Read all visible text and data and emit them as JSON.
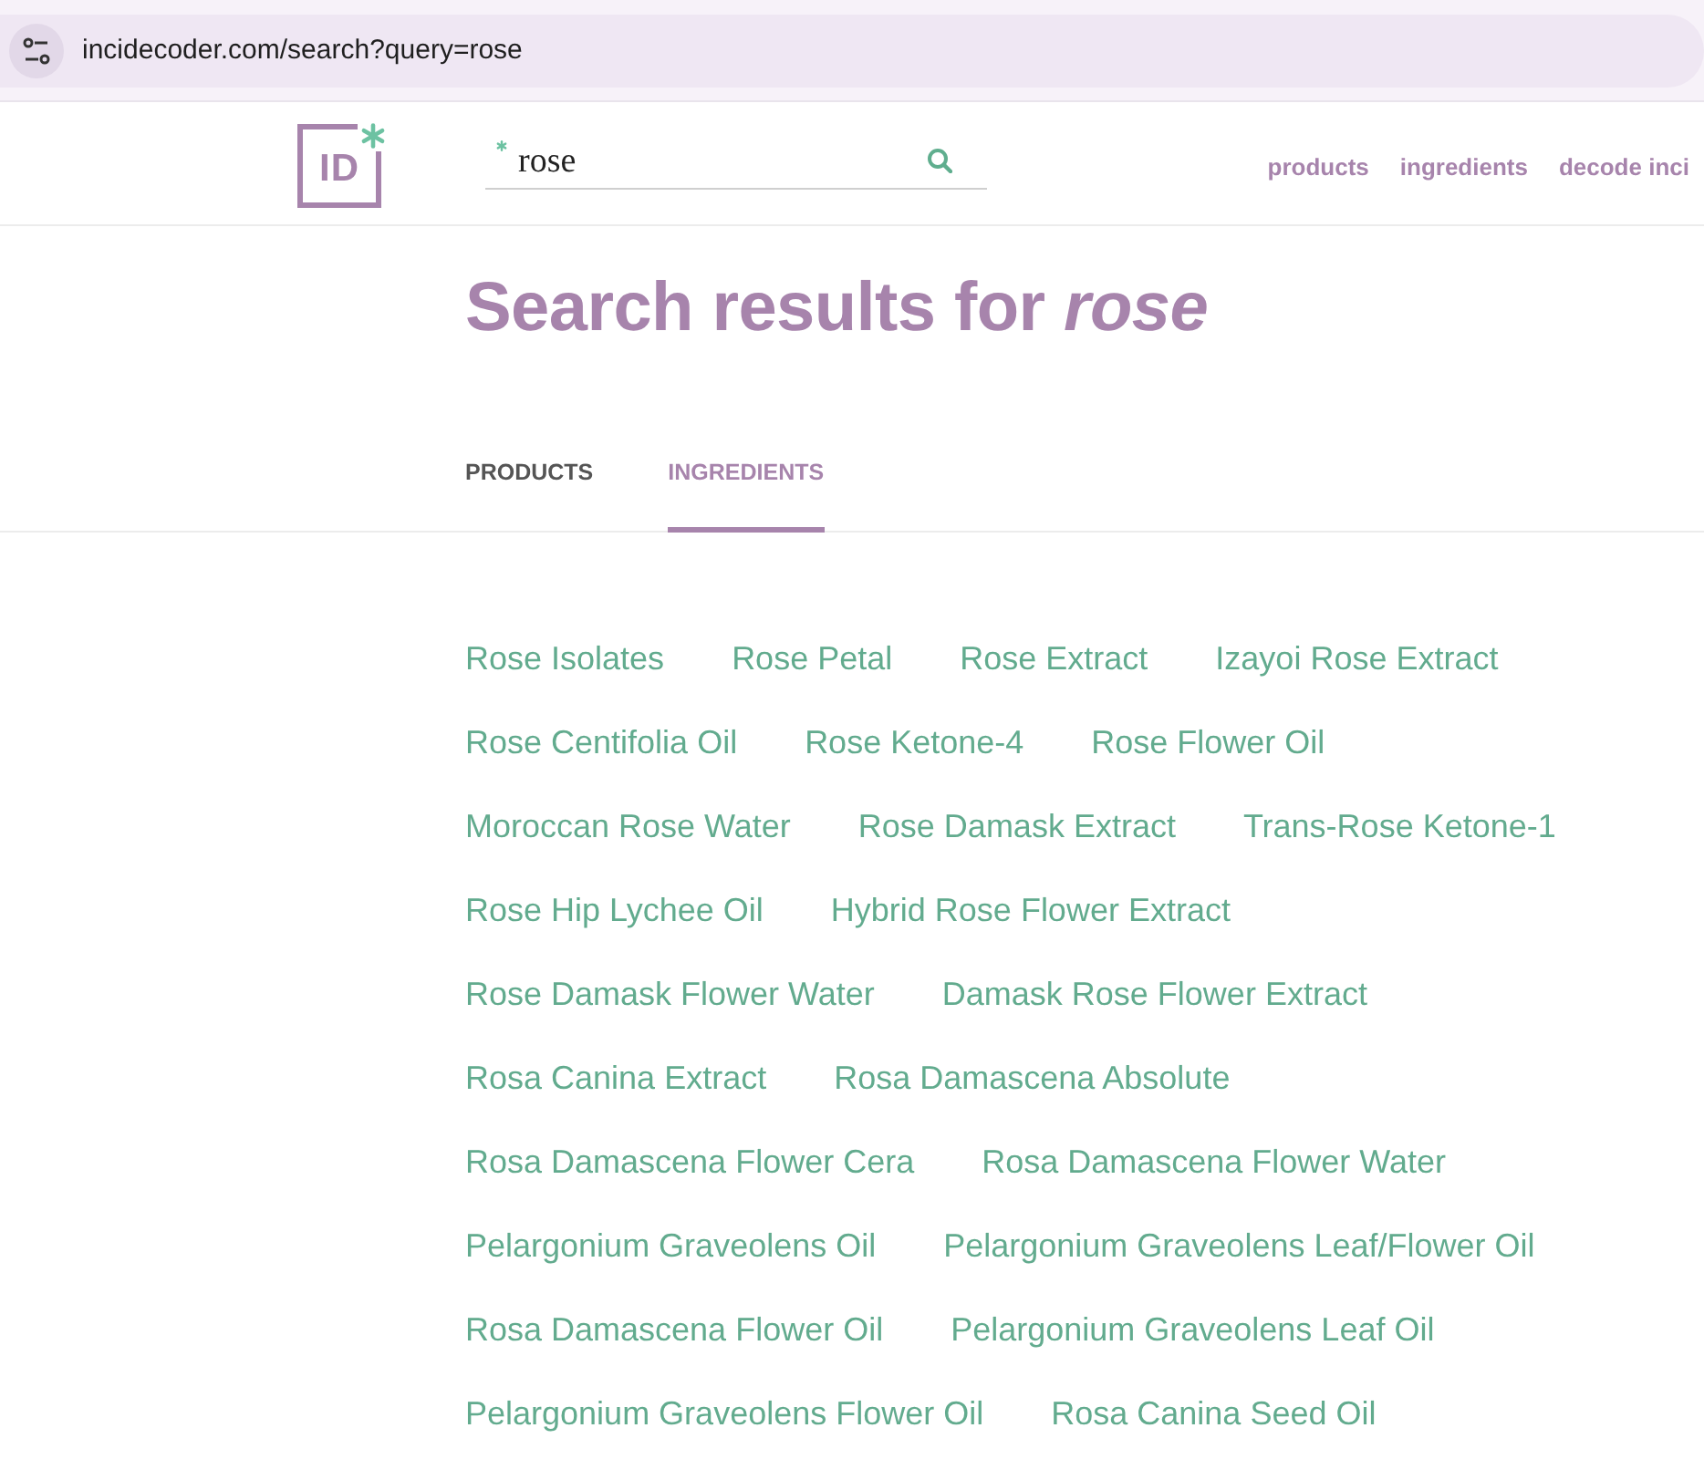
{
  "browser": {
    "url": "incidecoder.com/search?query=rose"
  },
  "header": {
    "logo": {
      "text": "ID"
    },
    "search": {
      "value": "rose"
    },
    "nav": [
      "products",
      "ingredients",
      "decode inci"
    ]
  },
  "heading": "Search results for *rose*",
  "tabs": [
    {
      "label": "PRODUCTS",
      "selected": false
    },
    {
      "label": "INGREDIENTS",
      "selected": true
    }
  ],
  "ingredient_rows": [
    [
      "Rose Isolates",
      "Rose Petal",
      "Rose Extract",
      "Izayoi Rose Extract"
    ],
    [
      "Rose Centifolia Oil",
      "Rose Ketone-4",
      "Rose Flower Oil"
    ],
    [
      "Moroccan Rose Water",
      "Rose Damask Extract",
      "Trans-Rose Ketone-1"
    ],
    [
      "Rose Hip Lychee Oil",
      "Hybrid Rose Flower Extract"
    ],
    [
      "Rose Damask Flower Water",
      "Damask Rose Flower Extract"
    ],
    [
      "Rosa Canina Extract",
      "Rosa Damascena Absolute"
    ],
    [
      "Rosa Damascena Flower Cera",
      "Rosa Damascena Flower Water"
    ],
    [
      "Pelargonium Graveolens Oil",
      "Pelargonium Graveolens Leaf/Flower Oil"
    ],
    [
      "Rosa Damascena Flower Oil",
      "Pelargonium Graveolens Leaf Oil"
    ],
    [
      "Pelargonium Graveolens Flower Oil",
      "Rosa Canina Seed Oil"
    ]
  ]
}
